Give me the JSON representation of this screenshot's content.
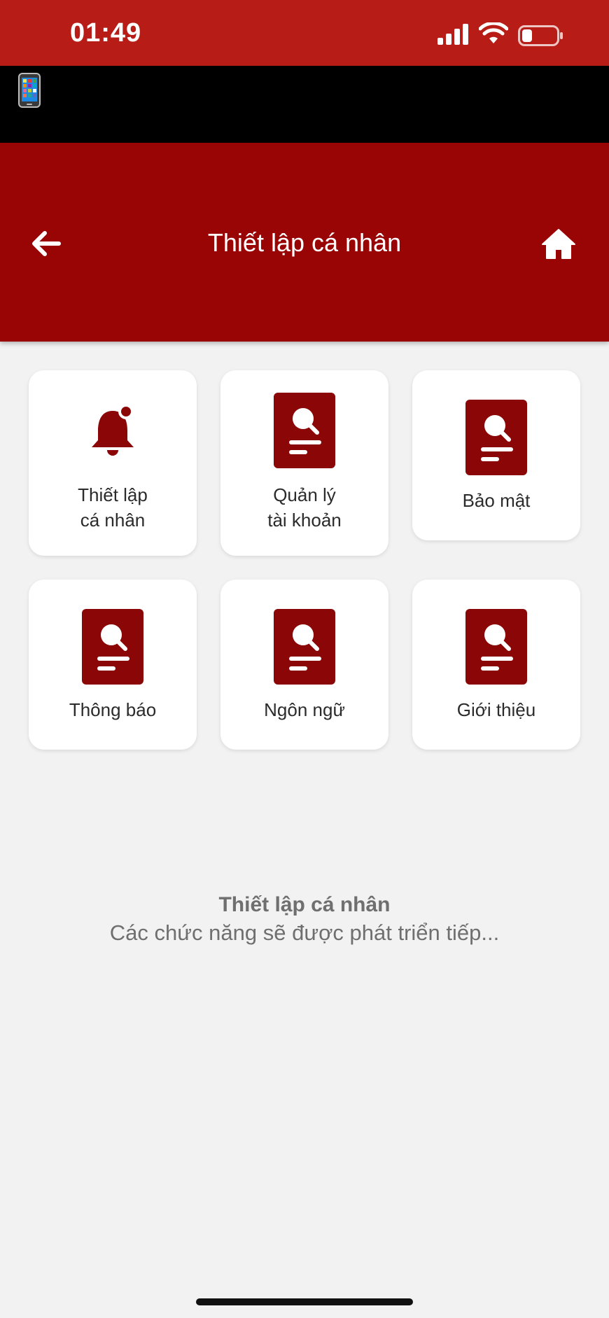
{
  "status_bar": {
    "time": "01:49"
  },
  "header": {
    "title": "Thiết lập cá nhân",
    "back_icon": "arrow-left-icon",
    "home_icon": "home-icon"
  },
  "grid": {
    "items": [
      {
        "line1": "Thiết lập",
        "line2": "cá nhân",
        "icon": "bell-icon"
      },
      {
        "line1": "Quản lý",
        "line2": "tài khoản",
        "icon": "document-search-icon"
      },
      {
        "line1": "Bảo mật",
        "line2": "",
        "icon": "document-search-icon"
      },
      {
        "line1": "Thông báo",
        "line2": "",
        "icon": "document-search-icon"
      },
      {
        "line1": "Ngôn ngữ",
        "line2": "",
        "icon": "document-search-icon"
      },
      {
        "line1": "Giới thiệu",
        "line2": "",
        "icon": "document-search-icon"
      }
    ]
  },
  "placeholder": {
    "title": "Thiết lập cá nhân",
    "subtitle": "Các chức năng sẽ được phát triển tiếp..."
  },
  "colors": {
    "status_bar": "#b71c17",
    "header": "#990505",
    "icon": "#8b0606",
    "background": "#f2f2f2"
  }
}
